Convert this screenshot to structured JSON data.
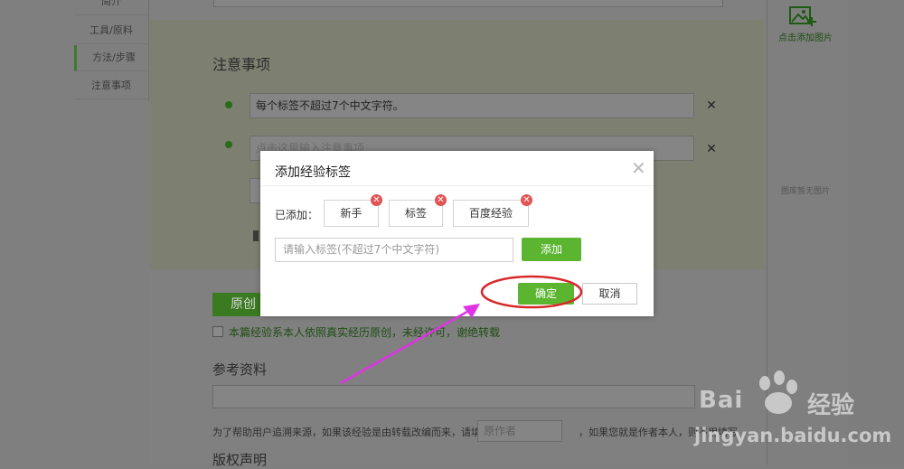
{
  "nav": {
    "items": [
      "简介",
      "工具/原料",
      "方法/步骤",
      "注意事项"
    ]
  },
  "tips": {
    "title": "注意事项",
    "items": [
      {
        "text": "每个标签不超过7个中文字符。"
      },
      {
        "text": "点击这里输入注意事项"
      }
    ]
  },
  "original": {
    "button_label": "原创",
    "declaration": "本篇经验系本人依照真实经历原创，未经许可，谢绝转载"
  },
  "reference": {
    "title": "参考资料",
    "help_text": "为了帮助用户追溯来源，如果该经验是由转载改编而来，请填写",
    "author_placeholder": "原作者",
    "help_text_2": "，如果您就是作者本人，则不用填写"
  },
  "copyright": {
    "title": "版权声明"
  },
  "gallery": {
    "add_label": "点击添加图片",
    "empty_label": "图库暂无图片"
  },
  "modal": {
    "title": "添加经验标签",
    "added_label": "已添加：",
    "tags": [
      "新手",
      "标签",
      "百度经验"
    ],
    "input_placeholder": "请输入标签(不超过7个中文字符)",
    "add_button": "添加",
    "confirm_button": "确定",
    "cancel_button": "取消"
  },
  "watermark": {
    "brand": "Bai",
    "brand_cn": "经验",
    "url": "jingyan.baidu.com"
  },
  "colors": {
    "accent_green": "#5cb531",
    "remove_red": "#e25454",
    "annotation_red": "#d8282a",
    "arrow_magenta": "#e033e6"
  }
}
